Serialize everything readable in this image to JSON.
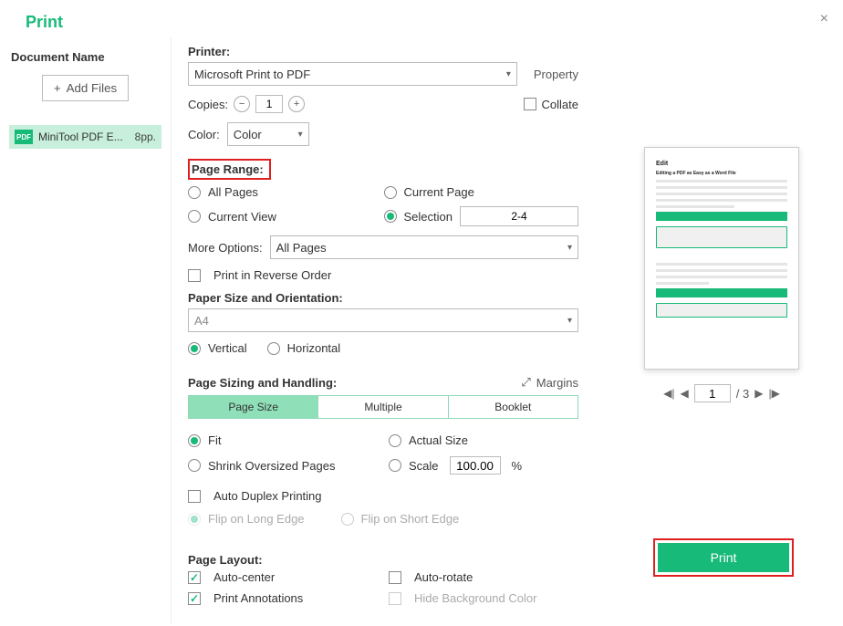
{
  "header": {
    "title": "Print"
  },
  "close_icon": "×",
  "left": {
    "doc_label": "Document Name",
    "add_files": "Add Files",
    "plus": "+",
    "file": {
      "icon": "PDF",
      "name": "MiniTool PDF E...",
      "pages": "8pp."
    }
  },
  "printer": {
    "label": "Printer:",
    "selected": "Microsoft Print to PDF",
    "property": "Property"
  },
  "copies": {
    "label": "Copies:",
    "value": "1",
    "minus": "−",
    "plus": "+",
    "collate": "Collate"
  },
  "color": {
    "label": "Color:",
    "selected": "Color"
  },
  "range": {
    "label": "Page Range:",
    "all": "All Pages",
    "current_page": "Current Page",
    "current_view": "Current View",
    "selection": "Selection",
    "selection_value": "2-4"
  },
  "more": {
    "label": "More Options:",
    "selected": "All Pages"
  },
  "reverse": "Print in Reverse Order",
  "paper": {
    "label": "Paper Size and Orientation:",
    "size": "A4",
    "vertical": "Vertical",
    "horizontal": "Horizontal"
  },
  "sizing": {
    "label": "Page Sizing and Handling:",
    "margins": "Margins",
    "tabs": {
      "page_size": "Page Size",
      "multiple": "Multiple",
      "booklet": "Booklet"
    },
    "fit": "Fit",
    "actual": "Actual Size",
    "shrink": "Shrink Oversized Pages",
    "scale": "Scale",
    "scale_value": "100.00",
    "percent": "%"
  },
  "duplex": {
    "auto": "Auto Duplex Printing",
    "long": "Flip on Long Edge",
    "short": "Flip on Short Edge"
  },
  "layout": {
    "label": "Page Layout:",
    "auto_center": "Auto-center",
    "auto_rotate": "Auto-rotate",
    "annotations": "Print Annotations",
    "hide_bg": "Hide Background Color"
  },
  "preview": {
    "title": "Edit",
    "subtitle": "Editing a PDF as Easy as a Word File"
  },
  "pager": {
    "current": "1",
    "total": "/ 3"
  },
  "print_btn": "Print",
  "chev": "▾"
}
